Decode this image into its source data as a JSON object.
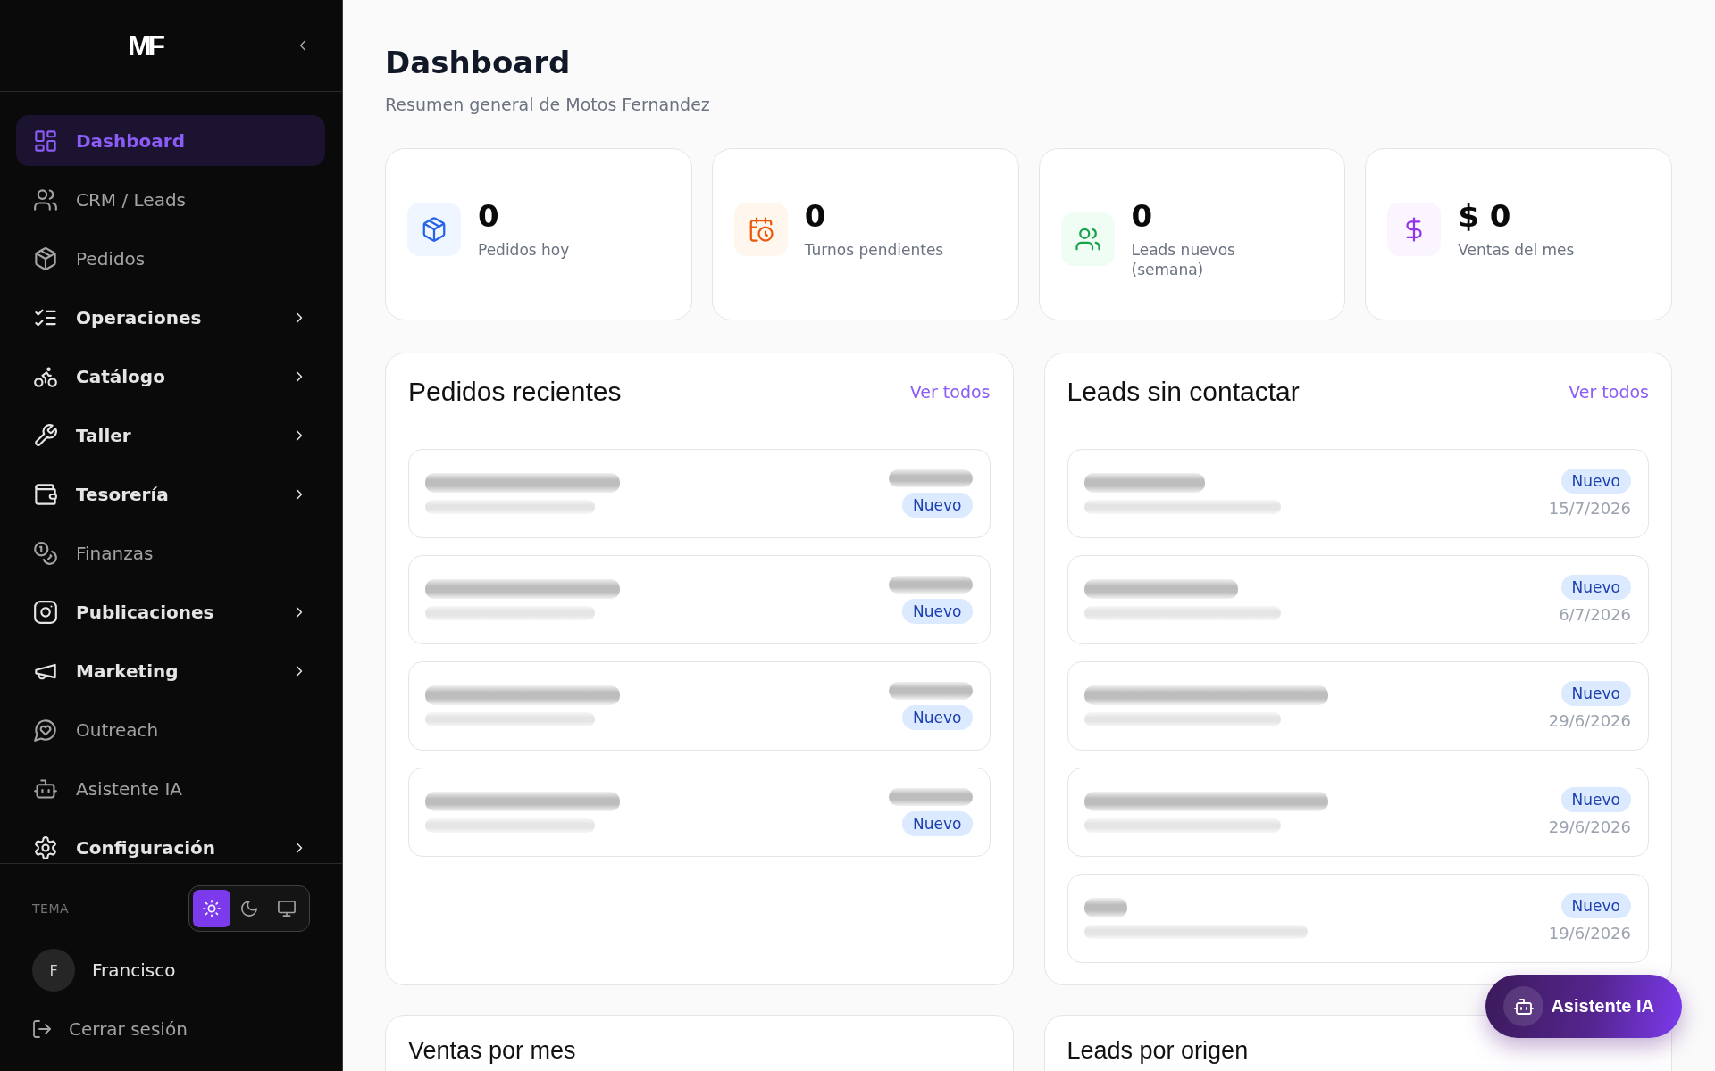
{
  "sidebar": {
    "logo": "MF",
    "nav": [
      {
        "label": "Dashboard",
        "kind": "link",
        "selected": true
      },
      {
        "label": "CRM / Leads",
        "kind": "link",
        "selected": false
      },
      {
        "label": "Pedidos",
        "kind": "link",
        "selected": false
      },
      {
        "label": "Operaciones",
        "kind": "group",
        "selected": false
      },
      {
        "label": "Catálogo",
        "kind": "group",
        "selected": false
      },
      {
        "label": "Taller",
        "kind": "group",
        "selected": false
      },
      {
        "label": "Tesorería",
        "kind": "group",
        "selected": false
      },
      {
        "label": "Finanzas",
        "kind": "link",
        "selected": false
      },
      {
        "label": "Publicaciones",
        "kind": "group",
        "selected": false
      },
      {
        "label": "Marketing",
        "kind": "group",
        "selected": false
      },
      {
        "label": "Outreach",
        "kind": "link",
        "selected": false
      },
      {
        "label": "Asistente IA",
        "kind": "link",
        "selected": false
      },
      {
        "label": "Configuración",
        "kind": "group",
        "selected": false
      }
    ],
    "theme": {
      "label": "TEMA",
      "options": [
        {
          "selected": true
        },
        {
          "selected": false
        },
        {
          "selected": false
        }
      ]
    },
    "user": {
      "initial": "F",
      "name": "Francisco"
    },
    "logout": "Cerrar sesión"
  },
  "header": {
    "title": "Dashboard",
    "subtitle": "Resumen general de Motos Fernandez"
  },
  "stats": [
    {
      "kind": "orders",
      "value": "0",
      "label": "Pedidos hoy"
    },
    {
      "kind": "turns",
      "value": "0",
      "label": "Turnos pendientes"
    },
    {
      "kind": "leads",
      "value": "0",
      "label": "Leads nuevos (semana)"
    },
    {
      "kind": "sales",
      "value": "$ 0",
      "label": "Ventas del mes"
    }
  ],
  "panels": [
    {
      "kind": "orders",
      "title": "Pedidos recientes",
      "link": "Ver todos",
      "rows": [
        {
          "status": "Nuevo"
        },
        {
          "status": "Nuevo"
        },
        {
          "status": "Nuevo"
        },
        {
          "status": "Nuevo"
        }
      ]
    },
    {
      "kind": "leads",
      "title": "Leads sin contactar",
      "link": "Ver todos",
      "rows": [
        {
          "status": "Nuevo",
          "date": "15/7/2026"
        },
        {
          "status": "Nuevo",
          "date": "6/7/2026"
        },
        {
          "status": "Nuevo",
          "date": "29/6/2026"
        },
        {
          "status": "Nuevo",
          "date": "29/6/2026"
        },
        {
          "status": "Nuevo",
          "date": "19/6/2026"
        }
      ]
    }
  ],
  "charts": [
    {
      "title": "Ventas por mes"
    },
    {
      "title": "Leads por origen"
    }
  ],
  "assistant_button": {
    "label": "Asistente IA"
  }
}
